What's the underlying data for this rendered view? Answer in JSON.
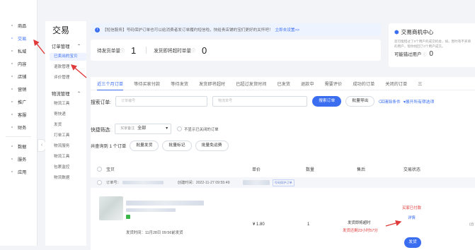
{
  "rail": {
    "items": [
      {
        "label": "商品",
        "icon": "box-icon"
      },
      {
        "label": "交易",
        "icon": "receipt-icon"
      },
      {
        "label": "私域",
        "icon": "chat-icon"
      },
      {
        "label": "内容",
        "icon": "content-icon"
      },
      {
        "label": "店铺",
        "icon": "store-icon"
      },
      {
        "label": "营销",
        "icon": "megaphone-icon"
      },
      {
        "label": "推广",
        "icon": "promote-icon"
      },
      {
        "label": "客服",
        "icon": "headset-icon"
      },
      {
        "label": "财务",
        "icon": "coin-icon"
      }
    ],
    "items2": [
      {
        "label": "数据",
        "icon": "data-icon"
      },
      {
        "label": "服务",
        "icon": "service-icon"
      },
      {
        "label": "应用",
        "icon": "apps-icon"
      }
    ]
  },
  "subnav": {
    "title": "交易",
    "group1": "订单管理",
    "items1": [
      "已卖出的宝贝",
      "退款管理",
      "评价管理"
    ],
    "group2": "物流管理",
    "items2": [
      "物流工具",
      "寄快递",
      "发货",
      "打单工具",
      "物流服务",
      "物流工具",
      "包裹监控",
      "物流数据"
    ]
  },
  "notice": {
    "text": "【短信服务】号码保护订单也可以给消费者发订单履约短信啦，快给贵店铺的宝们更好的关怀吧！",
    "link": "立即去设置>>"
  },
  "stats": [
    {
      "label": "待发货单量",
      "value": "1"
    },
    {
      "label": "发货即将超时单量",
      "value": "0"
    }
  ],
  "side_card": {
    "title": "交易商机中心",
    "desc": "您可能错过了0个用户的成交机会，如，暂时有不买单的用户，帮你找回了0个用户成交。",
    "footer_label": "可能错过用户",
    "footer_value": "0"
  },
  "tabs": [
    "近三个月订单",
    "等待买家付款",
    "等待发货",
    "发货即将超时",
    "已超过发货时间",
    "已发货",
    "退款中",
    "需要评价",
    "成功的订单",
    "关闭的订单",
    "三"
  ],
  "search": {
    "label": "搜索订单:",
    "order_placeholder": "订单编号",
    "logistics_placeholder": "物流单号",
    "search_btn": "搜索订单",
    "export_btn": "批量导出",
    "clear_link": "清除条件",
    "expand_link": "展开所有筛选项"
  },
  "filter": {
    "label": "快捷筛选:",
    "select_prefix": "买家备注",
    "select_value": "全部",
    "checkbox_label": "不显示已关闭的订单"
  },
  "selection": {
    "label": "共查询到 1 个订单",
    "buttons": [
      "批量发货",
      "批量标记",
      "批量免运费"
    ]
  },
  "table": {
    "headers": [
      "宝贝",
      "单价",
      "数量",
      "售后",
      "交易状态"
    ]
  },
  "order": {
    "order_no_label": "订单号：",
    "created_time": "创建时间：2022-11-27 09:55:49",
    "tag": "号码保护订单",
    "price": "¥ 1.80",
    "quantity": "1",
    "after_sale": "发货即将超时",
    "countdown": "发货还剩23小时57分",
    "status": "买家已付款",
    "detail_link": "详情",
    "ship_time": "发货时间：11月28日 09:56前发货",
    "ship_btn": "发货",
    "right_edge": "(合"
  },
  "colors": {
    "accent": "#3a6df0",
    "annotation": "#e03a3a"
  }
}
